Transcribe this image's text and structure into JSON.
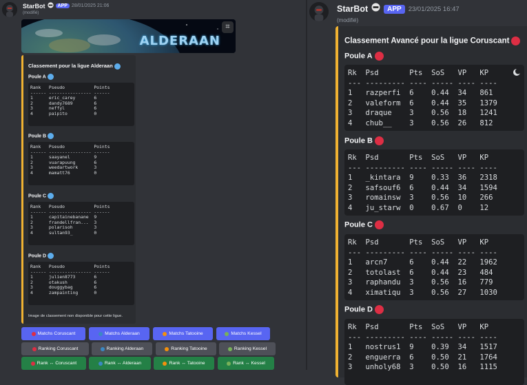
{
  "left": {
    "bot_name": "StarBot",
    "app_badge": "APP",
    "timestamp": "28/01/2025 21:06",
    "edited": "(modifié)",
    "banner_text": "ALDERAAN",
    "embed_title": "Classement pour la ligue Alderaan",
    "table_header": "Rank   Pseudo           Points",
    "table_sep": "------ ---------------- ------",
    "pools": [
      {
        "name": "Poule A",
        "rows": [
          "1      eric_carey       6",
          "2      dandy7689        6",
          "3      neffyl           6",
          "4      paipito          0"
        ]
      },
      {
        "name": "Poule B",
        "rows": [
          "1      saayanel         9",
          "2      vuarapuung       6",
          "3      weedartwork      3",
          "4      mamatt76         0"
        ]
      },
      {
        "name": "Poule C",
        "rows": [
          "1      capitainebanane  9",
          "2      frandellfran...  3",
          "3      polarisoh        3",
          "4      sultan93_        0"
        ]
      },
      {
        "name": "Poule D",
        "rows": [
          "1      julien8773       6",
          "2      otakush          6",
          "3      douggybag        6",
          "4      zampainting      0"
        ]
      }
    ],
    "note": "Image de classement non disponible pour cette ligue.",
    "buttons": [
      {
        "label": "Matchs Coruscant",
        "color": "#dd2e44"
      },
      {
        "label": "Matchs Alderaan",
        "color": "#3b88c3"
      },
      {
        "label": "Matchs Tatooine",
        "color": "#f4900c"
      },
      {
        "label": "Matchs Kessel",
        "color": "#78b159"
      },
      {
        "label": "Ranking Coruscant",
        "color": "#dd2e44"
      },
      {
        "label": "Ranking Alderaan",
        "color": "#3b88c3"
      },
      {
        "label": "Ranking Tatooine",
        "color": "#f4900c"
      },
      {
        "label": "Ranking Kessel",
        "color": "#78b159"
      },
      {
        "label": "Rank ↔ Coruscant",
        "color": "#dd2e44"
      },
      {
        "label": "Rank ↔ Alderaan",
        "color": "#3b88c3"
      },
      {
        "label": "Rank ↔ Tatooine",
        "color": "#f4900c"
      },
      {
        "label": "Rank ↔ Kessel",
        "color": "#78b159"
      }
    ]
  },
  "right": {
    "bot_name": "StarBot",
    "app_badge": "APP",
    "timestamp": "23/01/2025 16:47",
    "edited": "(modifié)",
    "embed_title": "Classement Avancé pour la ligue Coruscant",
    "table_header": "Rk  Psd       Pts  SoS   VP   KP",
    "table_sep": "--- --------- ---- ----- ---- ----",
    "pools": [
      {
        "name": "Poule A",
        "rows": [
          "1   razperfi  6    0.44  34   861",
          "2   valeform  6    0.44  35   1379",
          "3   draque    3    0.56  18   1241",
          "4   chub__    3    0.56  26   812"
        ]
      },
      {
        "name": "Poule B",
        "rows": [
          "1   _kintara  9    0.33  36   2318",
          "2   safsouf6  6    0.44  34   1594",
          "3   romainsw  3    0.56  10   266",
          "4   ju_starw  0    0.67  0    12"
        ]
      },
      {
        "name": "Poule C",
        "rows": [
          "1   arcn7     6    0.44  22   1962",
          "2   totolast  6    0.44  23   484",
          "3   raphandu  3    0.56  16   779",
          "4   ximatiqu  3    0.56  27   1030"
        ]
      },
      {
        "name": "Poule D",
        "rows": [
          "1   nostrus1  9    0.39  34   1517",
          "2   enguerra  6    0.50  21   1764",
          "3   unholy68  3    0.50  16   1115"
        ]
      }
    ]
  },
  "icons": {
    "banner_menu": "grid-icon",
    "copy": "theme-toggle-icon",
    "bot_badge": "stormtrooper-emoji"
  }
}
